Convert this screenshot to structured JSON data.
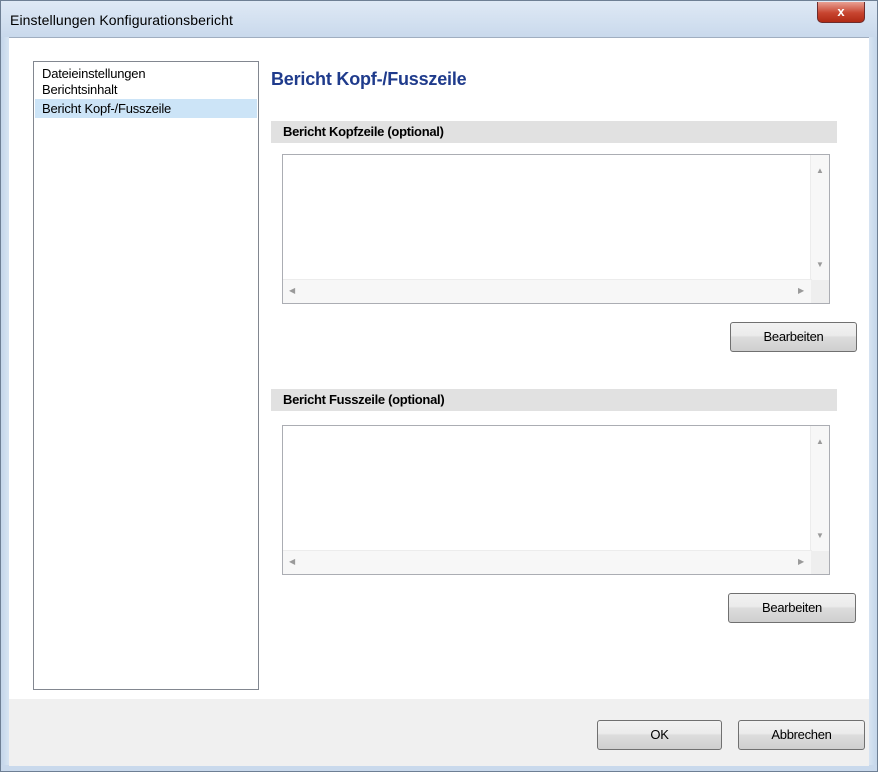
{
  "window": {
    "title": "Einstellungen Konfigurationsbericht",
    "close_label": "x"
  },
  "nav": {
    "items": [
      {
        "label": "Dateieinstellungen",
        "selected": false
      },
      {
        "label": "Berichtsinhalt",
        "selected": false
      },
      {
        "label": "Bericht Kopf-/Fusszeile",
        "selected": true
      }
    ]
  },
  "page": {
    "title": "Bericht Kopf-/Fusszeile"
  },
  "header_section": {
    "title": "Bericht Kopfzeile (optional)",
    "text": "",
    "edit_label": "Bearbeiten"
  },
  "footer_section": {
    "title": "Bericht Fusszeile (optional)",
    "text": "",
    "edit_label": "Bearbeiten"
  },
  "buttons": {
    "ok": "OK",
    "cancel": "Abbrechen"
  },
  "colors": {
    "title_blue": "#1f3b8c",
    "selection": "#cce4f7",
    "section_bg": "#e1e1e1"
  }
}
